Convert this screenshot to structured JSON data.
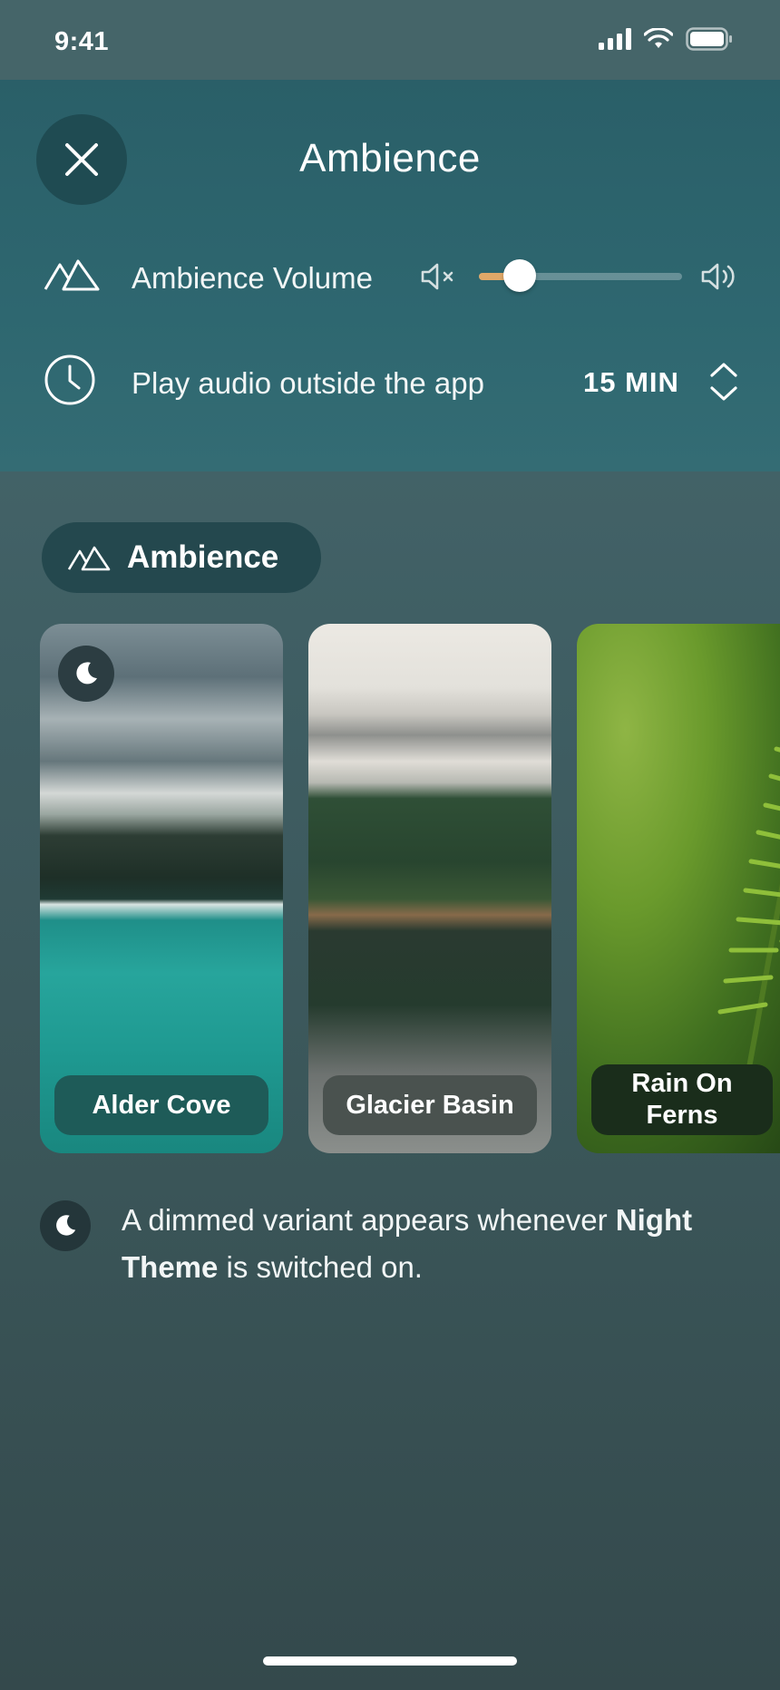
{
  "status_bar": {
    "time": "9:41"
  },
  "header": {
    "title": "Ambience",
    "close_icon": "close-icon"
  },
  "settings": {
    "volume": {
      "label": "Ambience Volume",
      "icon": "mountains-icon",
      "value_fraction": 0.2
    },
    "timer": {
      "label": "Play audio outside the app",
      "icon": "clock-icon",
      "value": "15 MIN"
    }
  },
  "category": {
    "label": "Ambience",
    "icon": "mountains-icon"
  },
  "cards": [
    {
      "label": "Alder Cove",
      "badge_icon": "moon-icon"
    },
    {
      "label": "Glacier Basin"
    },
    {
      "label": "Rain On Ferns"
    }
  ],
  "note": {
    "prefix": "A dimmed variant appears whenever ",
    "emphasis": "Night Theme",
    "suffix": " is switched on."
  },
  "colors": {
    "accent": "#e0a868",
    "sheet": "#2a5f68",
    "pill": "#24484e"
  }
}
